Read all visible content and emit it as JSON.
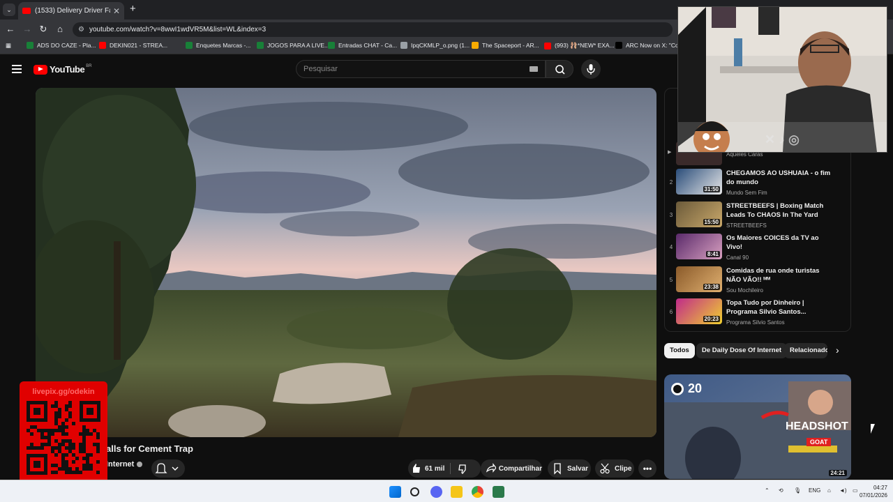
{
  "browser": {
    "tab_title": "(1533) Delivery Driver Falls for C",
    "tab_close": "✕",
    "new_tab": "+",
    "url": "youtube.com/watch?v=8wwI1wdVR5M&list=WL&index=3",
    "bookmarks": [
      {
        "label": "ADS DO CAZE - Pla...",
        "color": "#188038"
      },
      {
        "label": "DEKIN021 - STREA...",
        "color": "#ff0000"
      },
      {
        "label": "Enquetes Marcas -...",
        "color": "#188038"
      },
      {
        "label": "JOGOS PARA A LIVE...",
        "color": "#188038"
      },
      {
        "label": "Entradas CHAT - Ca...",
        "color": "#188038"
      },
      {
        "label": "IpqCKMLP_o.png (1...",
        "color": "#9aa0a6"
      },
      {
        "label": "The Spaceport - AR...",
        "color": "#f9ab00"
      },
      {
        "label": "(993) 🩰*NEW* EXA...",
        "color": "#ff0000"
      },
      {
        "label": "ARC Now on X: \"Co...",
        "color": "#000000"
      }
    ]
  },
  "youtube": {
    "logo_text": "YouTube",
    "country_code": "BR",
    "search_placeholder": "Pesquisar"
  },
  "video": {
    "title_visible": "alls for Cement Trap",
    "channel_visible": "Internet",
    "likes": "61 mil",
    "share_label": "Compartilhar",
    "save_label": "Salvar",
    "clip_label": "Clipe"
  },
  "overlay": {
    "qr_url": "livepix.gg/odekin"
  },
  "playlist": {
    "partial_channel": "Aqueles Caras",
    "items": [
      {
        "num": "2",
        "title": "CHEGAMOS AO USHUAIA - o fim do mundo",
        "channel": "Mundo Sem Fim",
        "duration": "31:50",
        "colors": [
          "#2a4d7a",
          "#e8e8e8"
        ]
      },
      {
        "num": "3",
        "title": "STREETBEEFS | Boxing Match Leads To CHAOS In The Yard",
        "channel": "STREETBEEFS",
        "duration": "15:50",
        "colors": [
          "#6b5a3a",
          "#c9a86a"
        ]
      },
      {
        "num": "4",
        "title": "Os Maiores COICES da TV ao Vivo!",
        "channel": "Canal 90",
        "duration": "8:41",
        "colors": [
          "#5a2a6a",
          "#d8a0c0"
        ]
      },
      {
        "num": "5",
        "title": "Comidas de rua onde turistas NÃO VÃO!! ᴹᴹ",
        "channel": "Sou Mochileiro",
        "duration": "23:38",
        "colors": [
          "#8a5a2a",
          "#e0b070"
        ]
      },
      {
        "num": "6",
        "title": "Topa Tudo por Dinheiro | Programa Silvio Santos...",
        "channel": "Programa Silvio Santos",
        "duration": "20:23",
        "colors": [
          "#c02a8a",
          "#f0d030"
        ]
      }
    ]
  },
  "chips": [
    {
      "label": "Todos",
      "active": true
    },
    {
      "label": "De Daily Dose Of Internet",
      "active": false
    },
    {
      "label": "Relacionado",
      "active": false
    }
  ],
  "recommended": {
    "kills": "20",
    "headshot": "HEADSHOT",
    "badge": "GOAT",
    "duration": "24:21"
  },
  "taskbar": {
    "lang": "ENG",
    "time": "04:27",
    "date": "07/01/2026"
  }
}
